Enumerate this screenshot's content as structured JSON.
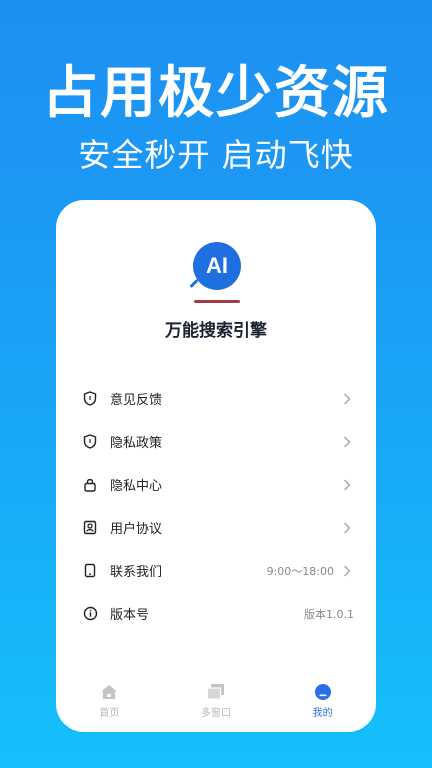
{
  "promo": {
    "headline": "占用极少资源",
    "subline": "安全秒开 启动飞快"
  },
  "app": {
    "logo_text": "AI",
    "name": "万能搜索引擎",
    "accent_color": "#1f6fe0"
  },
  "menu": {
    "items": [
      {
        "label": "意见反馈",
        "icon": "shield-icon",
        "value": ""
      },
      {
        "label": "隐私政策",
        "icon": "shield-icon",
        "value": ""
      },
      {
        "label": "隐私中心",
        "icon": "lock-icon",
        "value": ""
      },
      {
        "label": "用户协议",
        "icon": "user-doc-icon",
        "value": ""
      },
      {
        "label": "联系我们",
        "icon": "phone-icon",
        "value": "9:00～18:00"
      },
      {
        "label": "版本号",
        "icon": "info-icon",
        "value": "版本1.0.1"
      }
    ]
  },
  "tabbar": {
    "tabs": [
      {
        "label": "首页",
        "icon": "home-icon",
        "active": false
      },
      {
        "label": "多窗口",
        "icon": "windows-icon",
        "active": false
      },
      {
        "label": "我的",
        "icon": "profile-icon",
        "active": true
      }
    ]
  }
}
